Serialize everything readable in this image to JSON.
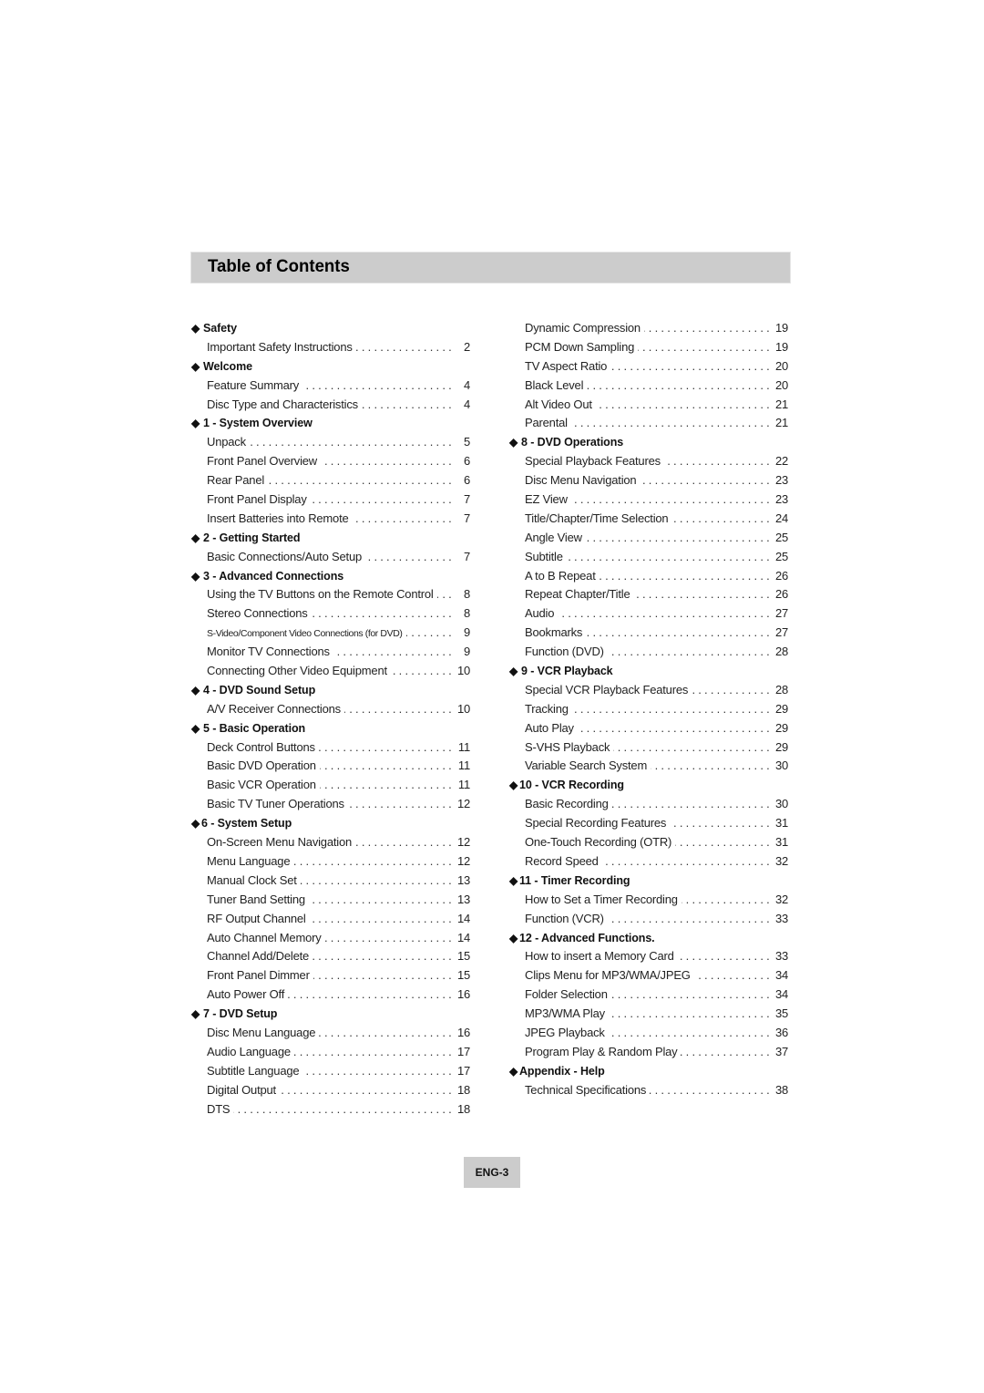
{
  "header": {
    "title": "Table of Contents"
  },
  "columns": [
    {
      "rows": [
        {
          "type": "section",
          "icon": "diamond-bullet",
          "title": "Safety"
        },
        {
          "type": "entry",
          "label": "Important Safety Instructions",
          "page": "2"
        },
        {
          "type": "section",
          "icon": "diamond-bullet",
          "title": "Welcome"
        },
        {
          "type": "entry",
          "label": "Feature Summary",
          "page": "4"
        },
        {
          "type": "entry",
          "label": "Disc Type and Characteristics",
          "page": "4"
        },
        {
          "type": "section",
          "icon": "diamond-bullet",
          "title": "1 - System Overview"
        },
        {
          "type": "entry",
          "label": "Unpack",
          "page": "5"
        },
        {
          "type": "entry",
          "label": "Front Panel Overview",
          "page": "6"
        },
        {
          "type": "entry",
          "label": "Rear Panel",
          "page": "6"
        },
        {
          "type": "entry",
          "label": "Front Panel Display",
          "page": "7"
        },
        {
          "type": "entry",
          "label": "Insert Batteries into Remote",
          "page": "7"
        },
        {
          "type": "section",
          "icon": "diamond-bullet",
          "title": "2 - Getting Started"
        },
        {
          "type": "entry",
          "label": "Basic Connections/Auto Setup",
          "page": "7"
        },
        {
          "type": "section",
          "icon": "diamond-bullet",
          "title": "3 - Advanced Connections"
        },
        {
          "type": "entry",
          "label": "Using the TV Buttons on the Remote Control",
          "page": "8"
        },
        {
          "type": "entry",
          "label": "Stereo Connections",
          "page": "8"
        },
        {
          "type": "entry",
          "label": "S-Video/Component Video Connections (for DVD)",
          "page": "9",
          "small": true
        },
        {
          "type": "entry",
          "label": "Monitor TV Connections",
          "page": "9"
        },
        {
          "type": "entry",
          "label": "Connecting Other Video Equipment",
          "page": "10"
        },
        {
          "type": "section",
          "icon": "diamond-bullet",
          "title": "4 - DVD Sound Setup"
        },
        {
          "type": "entry",
          "label": "A/V Receiver Connections",
          "page": "10"
        },
        {
          "type": "section",
          "icon": "diamond-bullet",
          "title": "5 - Basic Operation"
        },
        {
          "type": "entry",
          "label": "Deck Control Buttons",
          "page": "11"
        },
        {
          "type": "entry",
          "label": "Basic DVD Operation",
          "page": "11"
        },
        {
          "type": "entry",
          "label": "Basic VCR Operation",
          "page": "11"
        },
        {
          "type": "entry",
          "label": "Basic TV Tuner Operations",
          "page": "12"
        },
        {
          "type": "section",
          "icon": "diamond-bullet",
          "title": "6 - System Setup",
          "tight": true
        },
        {
          "type": "entry",
          "label": "On-Screen Menu Navigation",
          "page": "12"
        },
        {
          "type": "entry",
          "label": "Menu Language",
          "page": "12"
        },
        {
          "type": "entry",
          "label": "Manual Clock Set",
          "page": "13"
        },
        {
          "type": "entry",
          "label": "Tuner Band Setting",
          "page": "13"
        },
        {
          "type": "entry",
          "label": "RF Output Channel",
          "page": "14"
        },
        {
          "type": "entry",
          "label": "Auto Channel Memory",
          "page": "14"
        },
        {
          "type": "entry",
          "label": "Channel Add/Delete",
          "page": "15"
        },
        {
          "type": "entry",
          "label": "Front Panel Dimmer",
          "page": "15"
        },
        {
          "type": "entry",
          "label": "Auto Power Off",
          "page": "16"
        },
        {
          "type": "section",
          "icon": "diamond-bullet",
          "title": "7 - DVD Setup"
        },
        {
          "type": "entry",
          "label": "Disc Menu Language",
          "page": "16"
        },
        {
          "type": "entry",
          "label": "Audio Language",
          "page": "17"
        },
        {
          "type": "entry",
          "label": "Subtitle Language",
          "page": "17"
        },
        {
          "type": "entry",
          "label": "Digital Output",
          "page": "18"
        },
        {
          "type": "entry",
          "label": "DTS",
          "page": "18"
        }
      ]
    },
    {
      "rows": [
        {
          "type": "entry",
          "label": "Dynamic Compression",
          "page": "19"
        },
        {
          "type": "entry",
          "label": "PCM Down Sampling",
          "page": "19"
        },
        {
          "type": "entry",
          "label": "TV Aspect Ratio",
          "page": "20"
        },
        {
          "type": "entry",
          "label": "Black Level",
          "page": "20"
        },
        {
          "type": "entry",
          "label": "Alt Video Out",
          "page": "21"
        },
        {
          "type": "entry",
          "label": "Parental",
          "page": "21"
        },
        {
          "type": "section",
          "icon": "diamond-bullet",
          "title": "8 - DVD Operations"
        },
        {
          "type": "entry",
          "label": "Special Playback Features",
          "page": "22"
        },
        {
          "type": "entry",
          "label": "Disc Menu Navigation",
          "page": "23"
        },
        {
          "type": "entry",
          "label": "EZ View",
          "page": "23"
        },
        {
          "type": "entry",
          "label": "Title/Chapter/Time Selection",
          "page": "24"
        },
        {
          "type": "entry",
          "label": "Angle View",
          "page": "25"
        },
        {
          "type": "entry",
          "label": "Subtitle",
          "page": "25"
        },
        {
          "type": "entry",
          "label": "A to B Repeat",
          "page": "26"
        },
        {
          "type": "entry",
          "label": "Repeat Chapter/Title",
          "page": "26"
        },
        {
          "type": "entry",
          "label": "Audio",
          "page": "27"
        },
        {
          "type": "entry",
          "label": "Bookmarks",
          "page": "27"
        },
        {
          "type": "entry",
          "label": "Function (DVD)",
          "page": "28"
        },
        {
          "type": "section",
          "icon": "diamond-bullet",
          "title": "9 - VCR Playback"
        },
        {
          "type": "entry",
          "label": "Special VCR Playback Features",
          "page": "28"
        },
        {
          "type": "entry",
          "label": "Tracking",
          "page": "29"
        },
        {
          "type": "entry",
          "label": "Auto Play",
          "page": "29"
        },
        {
          "type": "entry",
          "label": "S-VHS Playback",
          "page": "29"
        },
        {
          "type": "entry",
          "label": "Variable Search System",
          "page": "30"
        },
        {
          "type": "section",
          "icon": "diamond-bullet",
          "title": "10 - VCR Recording",
          "tight": true
        },
        {
          "type": "entry",
          "label": "Basic Recording",
          "page": "30"
        },
        {
          "type": "entry",
          "label": "Special Recording Features",
          "page": "31"
        },
        {
          "type": "entry",
          "label": "One-Touch Recording (OTR)",
          "page": "31"
        },
        {
          "type": "entry",
          "label": "Record Speed",
          "page": "32"
        },
        {
          "type": "section",
          "icon": "diamond-bullet",
          "title": "11 - Timer Recording",
          "tight": true
        },
        {
          "type": "entry",
          "label": "How to Set a Timer Recording",
          "page": "32"
        },
        {
          "type": "entry",
          "label": "Function (VCR)",
          "page": "33"
        },
        {
          "type": "section",
          "icon": "diamond-bullet",
          "title": "12 - Advanced Functions.",
          "tight": true
        },
        {
          "type": "entry",
          "label": "How to insert a Memory Card",
          "page": "33"
        },
        {
          "type": "entry",
          "label": "Clips Menu for MP3/WMA/JPEG",
          "page": "34"
        },
        {
          "type": "entry",
          "label": "Folder Selection",
          "page": "34"
        },
        {
          "type": "entry",
          "label": "MP3/WMA Play",
          "page": "35"
        },
        {
          "type": "entry",
          "label": "JPEG Playback",
          "page": "36"
        },
        {
          "type": "entry",
          "label": "Program Play & Random Play",
          "page": "37"
        },
        {
          "type": "section",
          "icon": "diamond-bullet",
          "title": "Appendix - Help",
          "tight": true
        },
        {
          "type": "entry",
          "label": "Technical Specifications",
          "page": "38"
        }
      ]
    }
  ],
  "footer": {
    "page_label": "ENG-3"
  }
}
